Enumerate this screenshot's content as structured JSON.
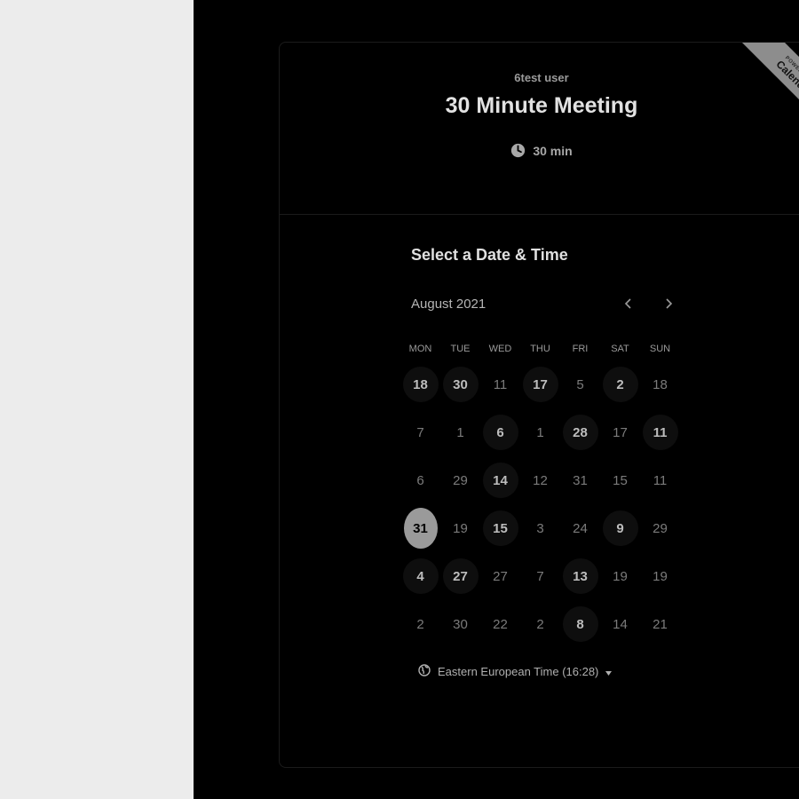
{
  "page": {
    "host_name": "6test user",
    "event_title": "30 Minute Meeting",
    "duration": "30 min",
    "section_title": "Select a Date & Time",
    "month": "August 2021",
    "weekdays": [
      "MON",
      "TUE",
      "WED",
      "THU",
      "FRI",
      "SAT",
      "SUN"
    ],
    "calendar": [
      [
        "18",
        "30",
        "11",
        "17",
        "5",
        "2",
        "18"
      ],
      [
        "7",
        "1",
        "6",
        "1",
        "28",
        "17",
        "11"
      ],
      [
        "6",
        "29",
        "14",
        "12",
        "31",
        "15",
        "11"
      ],
      [
        "31",
        "19",
        "15",
        "3",
        "24",
        "9",
        "29"
      ],
      [
        "4",
        "27",
        "27",
        "7",
        "13",
        "19",
        "19"
      ],
      [
        "2",
        "30",
        "22",
        "2",
        "8",
        "14",
        "21"
      ]
    ],
    "timezone": "Eastern European Time (16:28)",
    "ribbon_top": "POWERED BY",
    "ribbon_brand": "Calendly"
  },
  "colors": {
    "left_pane": "#ececec",
    "background": "#000000",
    "available_day": "#0e0e0e",
    "selected_day": "#9a9a9a",
    "ribbon": "#8d8d8d"
  },
  "icons": {
    "duration": "clock-icon",
    "timezone": "globe-icon",
    "prev": "chevron-left-icon",
    "next": "chevron-right-icon",
    "dropdown": "caret-down-icon"
  }
}
